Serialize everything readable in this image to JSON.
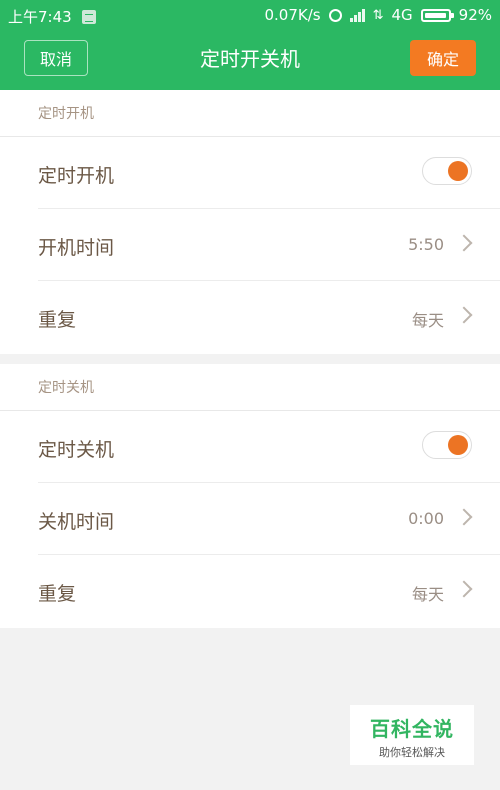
{
  "status_bar": {
    "time": "上午7:43",
    "network_speed": "0.07K/s",
    "network_type": "4G",
    "battery": "92%"
  },
  "header": {
    "cancel_label": "取消",
    "title": "定时开关机",
    "confirm_label": "确定"
  },
  "sections": [
    {
      "header": "定时开机",
      "toggle_label": "定时开机",
      "toggle_on": true,
      "time_label": "开机时间",
      "time_value": "5:50",
      "repeat_label": "重复",
      "repeat_value": "每天"
    },
    {
      "header": "定时关机",
      "toggle_label": "定时关机",
      "toggle_on": true,
      "time_label": "关机时间",
      "time_value": "0:00",
      "repeat_label": "重复",
      "repeat_value": "每天"
    }
  ],
  "watermark": {
    "title": "百科全说",
    "subtitle": "助你轻松解决"
  },
  "colors": {
    "header_bg": "#2bb863",
    "confirm_bg": "#f37a22",
    "toggle_on": "#ec7424"
  }
}
